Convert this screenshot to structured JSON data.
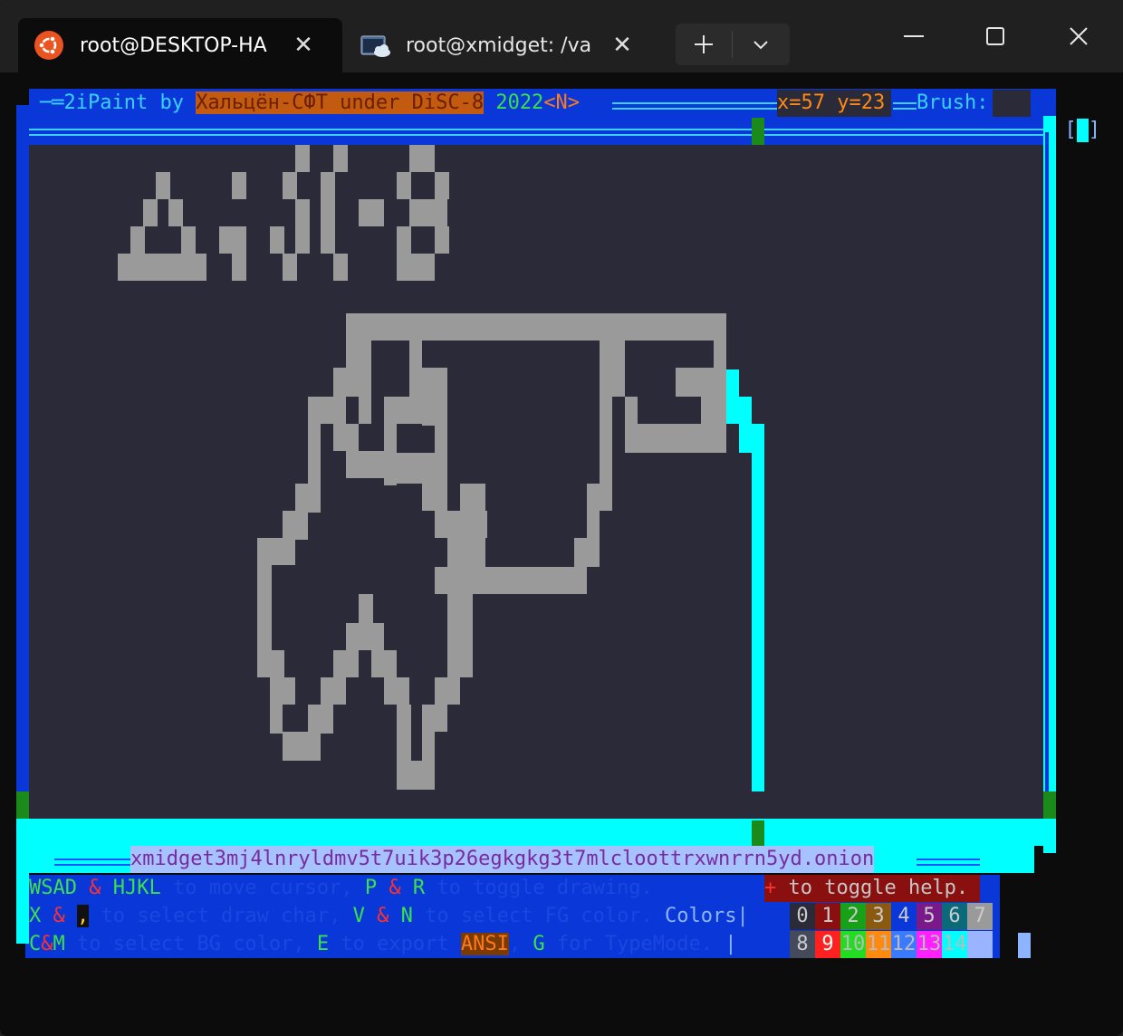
{
  "tabs": [
    {
      "title": "root@DESKTOP-HA",
      "icon": "ubuntu-icon",
      "close": "✕"
    },
    {
      "title": "root@xmidget: /var",
      "icon": "terminal-cloud-icon",
      "close": "✕"
    }
  ],
  "tab_actions": {
    "new_tab": "+",
    "dropdown": "⌄"
  },
  "window_controls": {
    "minimize": "—",
    "maximize": "☐",
    "close": "✕"
  },
  "header": {
    "lead": "─═2iPaint by ",
    "brand": "Хальцён-СФТ under DiSC-8",
    "year": " 2022",
    "mode": "<N>",
    "coords": "x=57 y=23",
    "brush_label": "Brush:",
    "brush_open": "[",
    "brush_close": "]"
  },
  "canvas_art": {
    "text_rows": [
      "             #  #     ##",
      "   #     #  #  #     #  #",
      "  # #       #  #  ##  ###",
      " #   #  ## # #  #     #  #",
      "#######  #  #  #     ###"
    ]
  },
  "footer": {
    "onion": "xmidget3mj4lnryldmv5t7uik3p26egkgkg3t7mlcloottrxwnrrn5yd.onion",
    "line1": {
      "k1": "WSAD",
      "amp1": " & ",
      "k2": "HJKL",
      "t1": " to move cursor, ",
      "k3": "P",
      "amp2": " & ",
      "k4": "R",
      "t2": " to toggle drawing.",
      "plus": "+",
      "help": " to toggle help."
    },
    "line2": {
      "k1": "X",
      "amp1": " & ",
      "comma": ",",
      "t1": " to select draw char, ",
      "k2": "V",
      "amp2": " & ",
      "k3": "N",
      "t2": " to select FG color.",
      "colors_label": " Colors|"
    },
    "line3": {
      "k1": "C",
      "amp": "&",
      "k2": "M",
      "t1": " to select BG color, ",
      "k3": "E",
      "t2": " to export ",
      "ansi": "ANSI",
      "t3": ", ",
      "k4": "G",
      "t4": " for TypeMode.",
      "bar": " |"
    }
  },
  "palette": {
    "row1": [
      {
        "label": "0",
        "bg": "#2a2a38",
        "fg": "#cccccc"
      },
      {
        "label": "1",
        "bg": "#8a0f0f",
        "fg": "#cccccc"
      },
      {
        "label": "2",
        "bg": "#18a018",
        "fg": "#cccccc"
      },
      {
        "label": "3",
        "bg": "#8a5a10",
        "fg": "#cccccc"
      },
      {
        "label": "4",
        "bg": "#0a38d8",
        "fg": "#cccccc"
      },
      {
        "label": "5",
        "bg": "#7a1a8a",
        "fg": "#cccccc"
      },
      {
        "label": "6",
        "bg": "#0a6a7a",
        "fg": "#cccccc"
      },
      {
        "label": "7",
        "bg": "#9a9a9a",
        "fg": "#cccccc"
      }
    ],
    "row2": [
      {
        "label": "8",
        "bg": "#444a5a",
        "fg": "#cccccc"
      },
      {
        "label": "9",
        "bg": "#ff2020",
        "fg": "#ffffff"
      },
      {
        "label": "10",
        "bg": "#22dd22",
        "fg": "#bbbbbb"
      },
      {
        "label": "11",
        "bg": "#ff8a10",
        "fg": "#bbbbbb"
      },
      {
        "label": "12",
        "bg": "#3a7aff",
        "fg": "#bbbbbb"
      },
      {
        "label": "13",
        "bg": "#ff20ff",
        "fg": "#bbbbbb"
      },
      {
        "label": "14",
        "bg": "#00ffff",
        "fg": "#bbbbbb"
      },
      {
        "label": "",
        "bg": "#9ab4ff",
        "fg": "#bbbbbb"
      }
    ]
  }
}
